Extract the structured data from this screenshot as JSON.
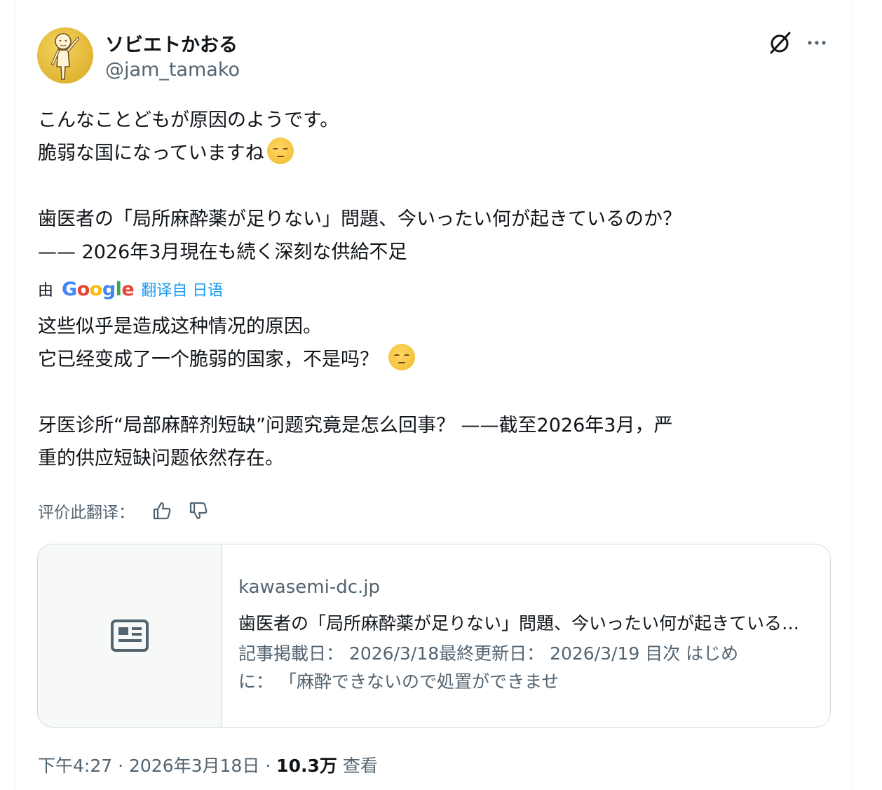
{
  "author": {
    "name": "ソビエトかおる",
    "handle": "@jam_tamako"
  },
  "icons": {
    "grok": "grok-icon",
    "more": "more-icon",
    "thumbs_up": "thumbs-up-icon",
    "thumbs_down": "thumbs-down-icon",
    "article": "article-icon",
    "emoji": "pensive-face-emoji"
  },
  "original_text": {
    "line1": "こんなことどもが原因のようです。",
    "line2": "脆弱な国になっていますね",
    "line3": "歯医者の「局所麻酔薬が足りない」問題、今いったい何が起きているのか？",
    "line4": "—— 2026年3月現在も続く深刻な供給不足"
  },
  "translation": {
    "by": "由",
    "google": "Google",
    "translated_from": "翻译自 日语",
    "line1": "这些似乎是造成这种情况的原因。",
    "line2": "它已经变成了一个脆弱的国家，不是吗？",
    "line3": "牙医诊所“局部麻醉剂短缺”问题究竟是怎么回事？ ——截至2026年3月，严",
    "line4": "重的供应短缺问题依然存在。",
    "rate_label": "评价此翻译："
  },
  "link_card": {
    "domain": "kawasemi-dc.jp",
    "title": "歯医者の「局所麻酔薬が足りない」問題、今いったい何が起きているのか？",
    "desc_line1": "記事掲載日： 2026/3/18最終更新日： 2026/3/19 目次 はじめ",
    "desc_line2": "に： 「麻酔できないので処置ができませ"
  },
  "meta": {
    "time": "下午4:27",
    "sep1": " · ",
    "date": "2026年3月18日",
    "sep2": " · ",
    "views_count": "10.3万",
    "views_label": "查看"
  },
  "colors": {
    "text": "#0f1419",
    "secondary": "#536471",
    "link": "#1d9bf0",
    "border": "#cfd9de"
  }
}
